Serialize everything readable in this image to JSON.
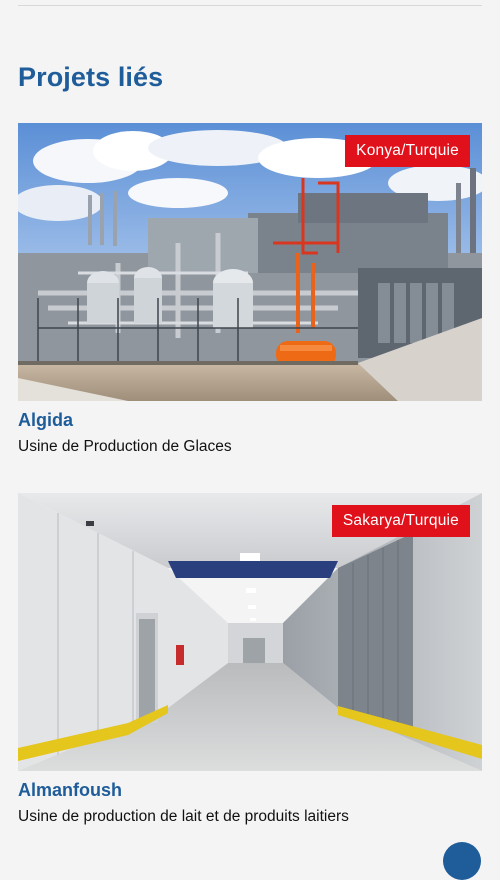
{
  "section": {
    "title": "Projets liés"
  },
  "projects": [
    {
      "location": "Konya/Turquie",
      "name": "Algida",
      "description": "Usine de Production de Glaces",
      "image_subject": "industrial-plant-photo"
    },
    {
      "location": "Sakarya/Turquie",
      "name": "Almanfoush",
      "description": "Usine de production de lait et de produits laitiers",
      "image_subject": "cold-storage-corridor-photo"
    }
  ],
  "colors": {
    "accent_blue": "#1e5c9a",
    "badge_red": "#e0111b",
    "background": "#f4f4f4",
    "text_dark": "#111111"
  },
  "icons": {
    "scroll_button": "scroll-to-top-button"
  }
}
